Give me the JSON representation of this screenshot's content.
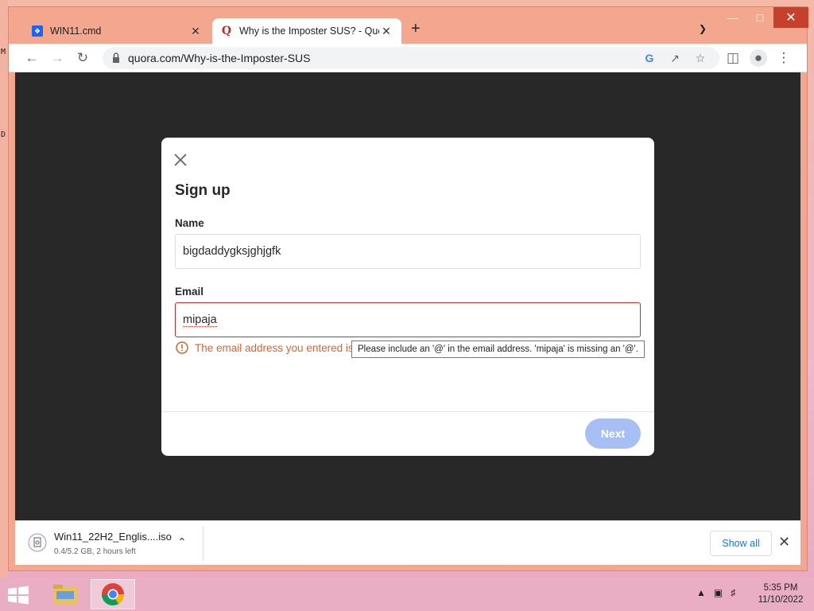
{
  "browser": {
    "tabs": [
      {
        "title": "WIN11.cmd",
        "favicon": "dropbox-icon",
        "active": false
      },
      {
        "title": "Why is the Imposter SUS? - Quora",
        "favicon": "quora-icon",
        "active": true
      }
    ],
    "url": "quora.com/Why-is-the-Imposter-SUS"
  },
  "modal": {
    "title": "Sign up",
    "name_label": "Name",
    "name_value": "bigdaddygksjghjgfk",
    "email_label": "Email",
    "email_value": "mipaja",
    "error_text": "The email address you entered is n",
    "tooltip": "Please include an '@' in the email address. 'mipaja' is missing an '@'.",
    "next_label": "Next"
  },
  "downloads": {
    "file_name": "Win11_22H2_Englis....iso",
    "status": "0.4/5.2 GB, 2 hours left",
    "show_all": "Show all"
  },
  "taskbar": {
    "time": "5:35 PM",
    "date": "11/10/2022"
  },
  "colors": {
    "error": "#cb2b2b",
    "next_button": "#a7bff5",
    "chrome_frame": "#f2a78e"
  }
}
